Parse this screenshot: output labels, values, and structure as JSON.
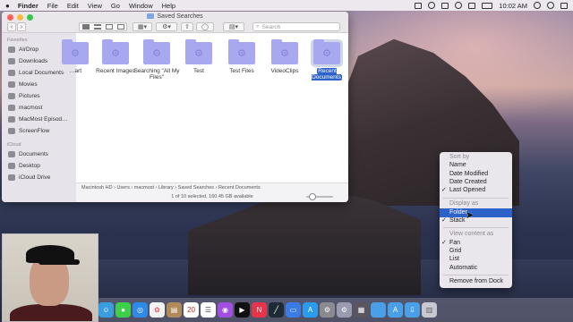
{
  "menubar": {
    "apple": "",
    "app": "Finder",
    "items": [
      "File",
      "Edit",
      "View",
      "Go",
      "Window",
      "Help"
    ],
    "clock": "10:02 AM"
  },
  "window": {
    "title": "Saved Searches",
    "search_placeholder": "Search",
    "nav_back": "‹",
    "nav_fwd": "›"
  },
  "sidebar": {
    "favorites_header": "Favorites",
    "favorites": [
      "AirDrop",
      "Downloads",
      "Local Documents",
      "Movies",
      "Pictures",
      "macmost",
      "MacMost Episod…",
      "ScreenFlow"
    ],
    "icloud_header": "iCloud",
    "icloud": [
      "Documents",
      "Desktop",
      "iCloud Drive"
    ]
  },
  "items": [
    {
      "label": "…art",
      "selected": false
    },
    {
      "label": "Recent Images",
      "selected": false
    },
    {
      "label": "Searching \"All My Files\"",
      "selected": false
    },
    {
      "label": "Test",
      "selected": false
    },
    {
      "label": "Test Files",
      "selected": false
    },
    {
      "label": "VideoClips",
      "selected": false
    },
    {
      "label": "Recent Documents",
      "selected": true
    }
  ],
  "pathbar": {
    "crumbs": [
      "Macintosh HD",
      "Users",
      "macmost",
      "Library",
      "Saved Searches",
      "Recent Documents"
    ],
    "separator": "›"
  },
  "status": "1 of 10 selected, 160.45 GB available",
  "context_menu": {
    "sort_header": "Sort by",
    "sort_items": [
      "Name",
      "Date Modified",
      "Date Created",
      "Last Opened"
    ],
    "display_header": "Display as",
    "display_items": [
      "Folder",
      "Stack"
    ],
    "view_header": "View content as",
    "view_items": [
      "Fan",
      "Grid",
      "List",
      "Automatic"
    ],
    "remove": "Remove from Dock",
    "check": "✓"
  },
  "dock": {
    "icons": [
      "finder-icon",
      "messages-icon",
      "safari-icon",
      "photos-icon",
      "notes-icon",
      "calendar-icon",
      "reminders-icon",
      "podcasts-icon",
      "tv-icon",
      "news-icon",
      "stocks-icon",
      "keynote-icon",
      "app-store-icon",
      "system-prefs-icon",
      "automator-icon",
      "stack-folder-icon",
      "folder-icon",
      "downloads-icon",
      "trash-icon"
    ],
    "calendar_day": "20"
  },
  "colors": {
    "accent": "#2d62c8",
    "folder": "#a8a8f0"
  }
}
